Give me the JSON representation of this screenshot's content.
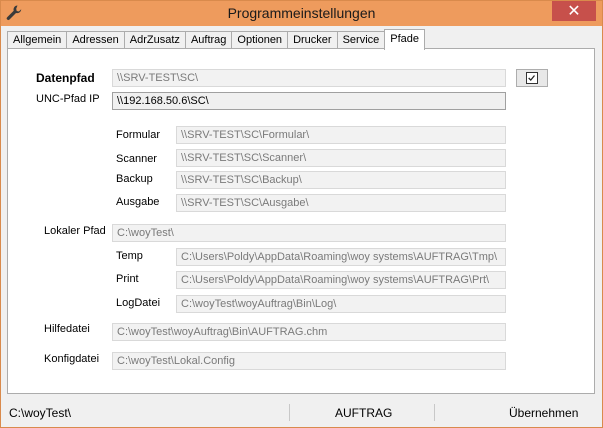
{
  "window": {
    "title": "Programmeinstellungen",
    "close_glyph": "✕",
    "app_icon": "wrench-icon"
  },
  "tabs": [
    {
      "label": "Allgemein",
      "active": false
    },
    {
      "label": "Adressen",
      "active": false
    },
    {
      "label": "AdrZusatz",
      "active": false
    },
    {
      "label": "Auftrag",
      "active": false
    },
    {
      "label": "Optionen",
      "active": false
    },
    {
      "label": "Drucker",
      "active": false
    },
    {
      "label": "Service",
      "active": false
    },
    {
      "label": "Pfade",
      "active": true
    }
  ],
  "paths": {
    "datenpfad": {
      "label": "Datenpfad",
      "value": "\\\\SRV-TEST\\SC\\"
    },
    "unc": {
      "label": "UNC-Pfad IP",
      "value": "\\\\192.168.50.6\\SC\\"
    },
    "formular": {
      "label": "Formular",
      "value": "\\\\SRV-TEST\\SC\\Formular\\"
    },
    "scanner": {
      "label": "Scanner",
      "value": "\\\\SRV-TEST\\SC\\Scanner\\"
    },
    "backup": {
      "label": "Backup",
      "value": "\\\\SRV-TEST\\SC\\Backup\\"
    },
    "ausgabe": {
      "label": "Ausgabe",
      "value": "\\\\SRV-TEST\\SC\\Ausgabe\\"
    },
    "lokaler_pfad": {
      "label": "Lokaler Pfad",
      "value": "C:\\woyTest\\"
    },
    "temp": {
      "label": "Temp",
      "value": "C:\\Users\\Poldy\\AppData\\Roaming\\woy systems\\AUFTRAG\\Tmp\\"
    },
    "print": {
      "label": "Print",
      "value": "C:\\Users\\Poldy\\AppData\\Roaming\\woy systems\\AUFTRAG\\Prt\\"
    },
    "logdatei": {
      "label": "LogDatei",
      "value": "C:\\woyTest\\woyAuftrag\\Bin\\Log\\"
    },
    "hilfedatei": {
      "label": "Hilfedatei",
      "value": "C:\\woyTest\\woyAuftrag\\Bin\\AUFTRAG.chm"
    },
    "konfigdatei": {
      "label": "Konfigdatei",
      "value": "C:\\woyTest\\Lokal.Config"
    }
  },
  "datenpfad_checked": true,
  "statusbar": {
    "path": "C:\\woyTest\\",
    "app": "AUFTRAG",
    "apply": "Übernehmen"
  }
}
